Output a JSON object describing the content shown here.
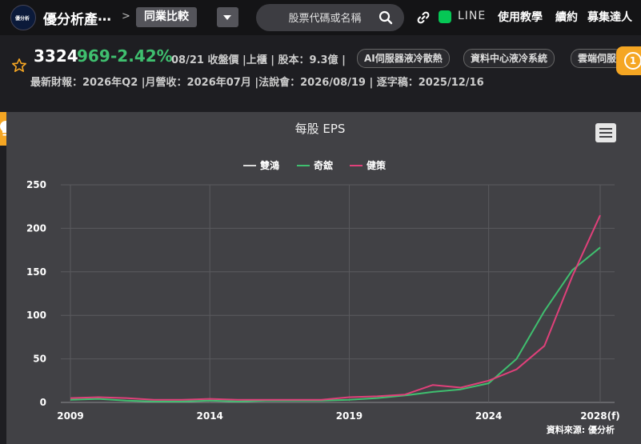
{
  "header": {
    "site_name": "優分析產⋯",
    "crumb_sep": ">",
    "active_tab": "同業比較",
    "search_placeholder": "股票代碼或名稱",
    "line_label": "LINE",
    "nav": [
      "使用教學",
      "續約",
      "募集達人"
    ],
    "logo_text": "優分析"
  },
  "stock": {
    "code": "3324",
    "price": "969",
    "change": "-2.42%",
    "meta": "08/21 收盤價 |上櫃 | 股本：9.3億 |",
    "tags": [
      "AI伺服器液冷散熱",
      "資料中心液冷系統",
      "雲端伺服"
    ],
    "info": "最新財報：2026年Q2 |月營收：2026年07月 |法說會：2026/08/19 | 逐字稿：2025/12/16",
    "badge": "1"
  },
  "colors": {
    "up_down": "#3fbf6f",
    "accent": "#f5a623"
  },
  "chart_data": {
    "type": "line",
    "title": "每股 EPS",
    "source": "資料來源: 優分析",
    "x": [
      "2009",
      "2010",
      "2011",
      "2012",
      "2013",
      "2014",
      "2015",
      "2016",
      "2017",
      "2018",
      "2019",
      "2020",
      "2021",
      "2022",
      "2023",
      "2024",
      "2025",
      "2026",
      "2027",
      "2028(f)"
    ],
    "x_ticks": [
      "2009",
      "2014",
      "2019",
      "2024",
      "2028(f)"
    ],
    "y_ticks": [
      0,
      50,
      100,
      150,
      200,
      250
    ],
    "ylim": [
      0,
      250
    ],
    "grid": true,
    "legend_position": "top-center",
    "series": [
      {
        "name": "雙鴻",
        "color": "#d9d9d9",
        "values": [
          null,
          null,
          null,
          null,
          null,
          null,
          null,
          null,
          null,
          null,
          null,
          null,
          null,
          null,
          null,
          null,
          null,
          null,
          null,
          null
        ]
      },
      {
        "name": "奇鋐",
        "color": "#3fbf6f",
        "values": [
          3,
          4,
          2,
          1,
          1,
          2,
          1,
          2,
          2,
          2,
          3,
          5,
          8,
          12,
          15,
          22,
          50,
          105,
          152,
          178
        ]
      },
      {
        "name": "健策",
        "color": "#e0407a",
        "values": [
          5,
          6,
          5,
          3,
          3,
          4,
          3,
          3,
          3,
          3,
          6,
          7,
          9,
          20,
          17,
          25,
          38,
          65,
          145,
          215
        ]
      }
    ]
  }
}
